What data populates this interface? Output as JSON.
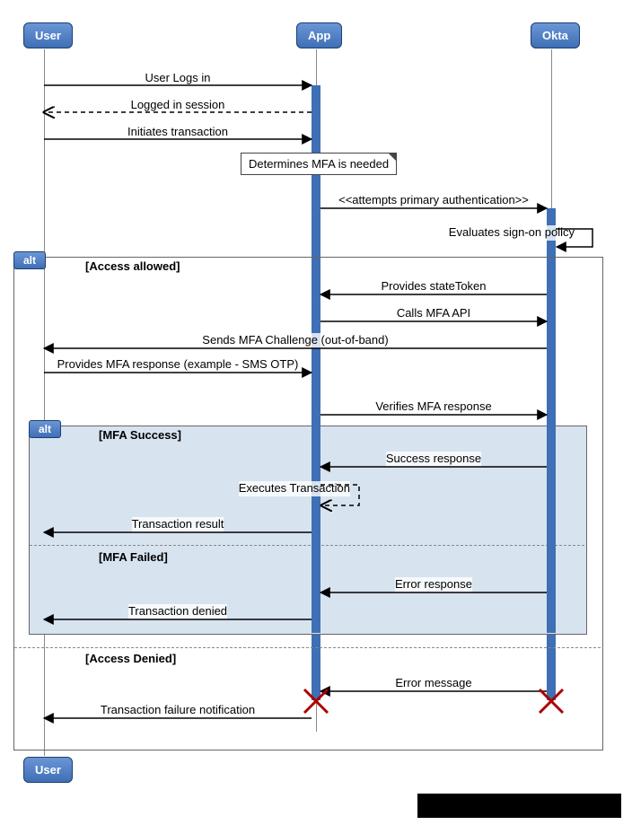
{
  "actors": {
    "user": "User",
    "app": "App",
    "okta": "Okta"
  },
  "messages": {
    "m1": "User Logs in",
    "m2": "Logged in session",
    "m3": "Initiates transaction",
    "note1": "Determines MFA is needed",
    "m4": "<<attempts primary authentication>>",
    "m5": "Evaluates sign-on policy",
    "m6": "Provides stateToken",
    "m7": "Calls MFA API",
    "m8": "Sends MFA Challenge (out-of-band)",
    "m9": "Provides MFA response (example - SMS OTP)",
    "m10": "Verifies MFA response",
    "m11": "Success response",
    "m12": "Executes Transaction",
    "m13": "Transaction result",
    "m14": "Error response",
    "m15": "Transaction denied",
    "m16": "Error message",
    "m17": "Transaction failure notification"
  },
  "frames": {
    "outer_tag": "alt",
    "outer_g1": "[Access allowed]",
    "outer_g2": "[Access Denied]",
    "inner_tag": "alt",
    "inner_g1": "[MFA Success]",
    "inner_g2": "[MFA Failed]"
  },
  "chart_data": {
    "type": "sequence",
    "participants": [
      "User",
      "App",
      "Okta"
    ],
    "interactions": [
      {
        "from": "User",
        "to": "App",
        "label": "User Logs in",
        "style": "solid"
      },
      {
        "from": "App",
        "to": "User",
        "label": "Logged in session",
        "style": "dashed-return"
      },
      {
        "from": "User",
        "to": "App",
        "label": "Initiates transaction",
        "style": "solid"
      },
      {
        "note_over": "App",
        "label": "Determines MFA is needed"
      },
      {
        "from": "App",
        "to": "Okta",
        "label": "<<attempts primary authentication>>",
        "style": "solid"
      },
      {
        "from": "Okta",
        "to": "Okta",
        "label": "Evaluates sign-on policy",
        "style": "self"
      },
      {
        "frame": "alt",
        "guard": "[Access allowed]",
        "children": [
          {
            "from": "Okta",
            "to": "App",
            "label": "Provides stateToken",
            "style": "solid"
          },
          {
            "from": "App",
            "to": "Okta",
            "label": "Calls MFA API",
            "style": "solid"
          },
          {
            "from": "Okta",
            "to": "User",
            "label": "Sends MFA Challenge (out-of-band)",
            "style": "solid"
          },
          {
            "from": "User",
            "to": "App",
            "label": "Provides MFA response (example - SMS OTP)",
            "style": "solid"
          },
          {
            "from": "App",
            "to": "Okta",
            "label": "Verifies MFA response",
            "style": "solid"
          },
          {
            "frame": "alt",
            "guard": "[MFA Success]",
            "children": [
              {
                "from": "Okta",
                "to": "App",
                "label": "Success response",
                "style": "solid"
              },
              {
                "from": "App",
                "to": "App",
                "label": "Executes Transaction",
                "style": "self-dashed"
              },
              {
                "from": "App",
                "to": "User",
                "label": "Transaction result",
                "style": "solid"
              }
            ],
            "else_guard": "[MFA Failed]",
            "else_children": [
              {
                "from": "Okta",
                "to": "App",
                "label": "Error response",
                "style": "solid"
              },
              {
                "from": "App",
                "to": "User",
                "label": "Transaction denied",
                "style": "solid"
              }
            ]
          }
        ],
        "else_guard": "[Access Denied]",
        "else_children": [
          {
            "from": "Okta",
            "to": "App",
            "label": "Error message",
            "style": "solid",
            "destroy_from": true
          },
          {
            "from": "App",
            "to": "User",
            "label": "Transaction failure notification",
            "style": "solid",
            "destroy_from": true
          }
        ]
      }
    ]
  }
}
